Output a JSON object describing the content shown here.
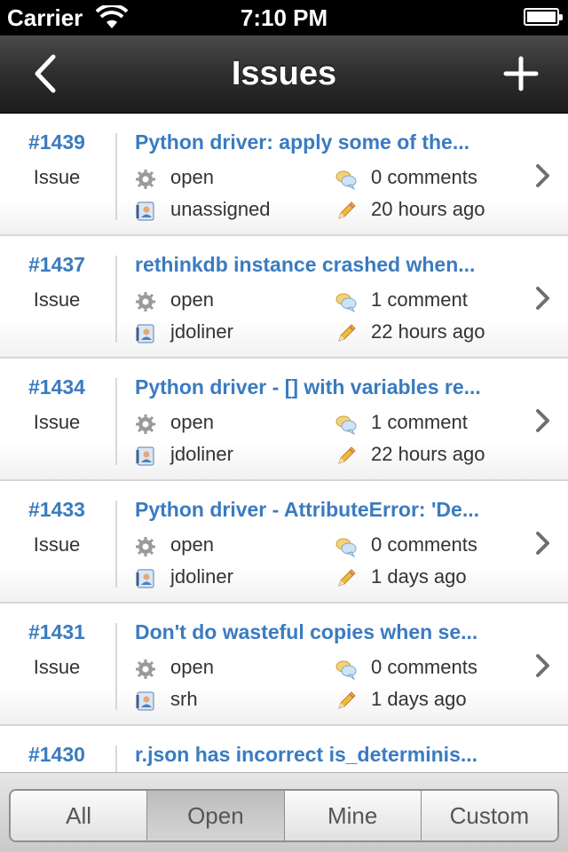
{
  "status_bar": {
    "carrier": "Carrier",
    "time": "7:10 PM"
  },
  "nav": {
    "title": "Issues",
    "back_icon": "chevron-left-icon",
    "add_icon": "plus-icon"
  },
  "issues": [
    {
      "number": "#1439",
      "type": "Issue",
      "title": "Python driver: apply some of the...",
      "state": "open",
      "comments": "0 comments",
      "assignee": "unassigned",
      "updated": "20 hours ago"
    },
    {
      "number": "#1437",
      "type": "Issue",
      "title": "rethinkdb instance crashed when...",
      "state": "open",
      "comments": "1 comment",
      "assignee": "jdoliner",
      "updated": "22 hours ago"
    },
    {
      "number": "#1434",
      "type": "Issue",
      "title": "Python driver - [] with variables re...",
      "state": "open",
      "comments": "1 comment",
      "assignee": "jdoliner",
      "updated": "22 hours ago"
    },
    {
      "number": "#1433",
      "type": "Issue",
      "title": "Python driver - AttributeError: 'De...",
      "state": "open",
      "comments": "0 comments",
      "assignee": "jdoliner",
      "updated": "1 days ago"
    },
    {
      "number": "#1431",
      "type": "Issue",
      "title": "Don't do wasteful copies when se...",
      "state": "open",
      "comments": "0 comments",
      "assignee": "srh",
      "updated": "1 days ago"
    },
    {
      "number": "#1430",
      "type": "",
      "title": "r.json has incorrect is_determinis...",
      "state": "",
      "comments": "",
      "assignee": "",
      "updated": ""
    }
  ],
  "filter": {
    "segments": [
      "All",
      "Open",
      "Mine",
      "Custom"
    ],
    "selected": "Open"
  },
  "colors": {
    "link": "#3a7bc0",
    "nav_bar": "#2e2e2e"
  }
}
